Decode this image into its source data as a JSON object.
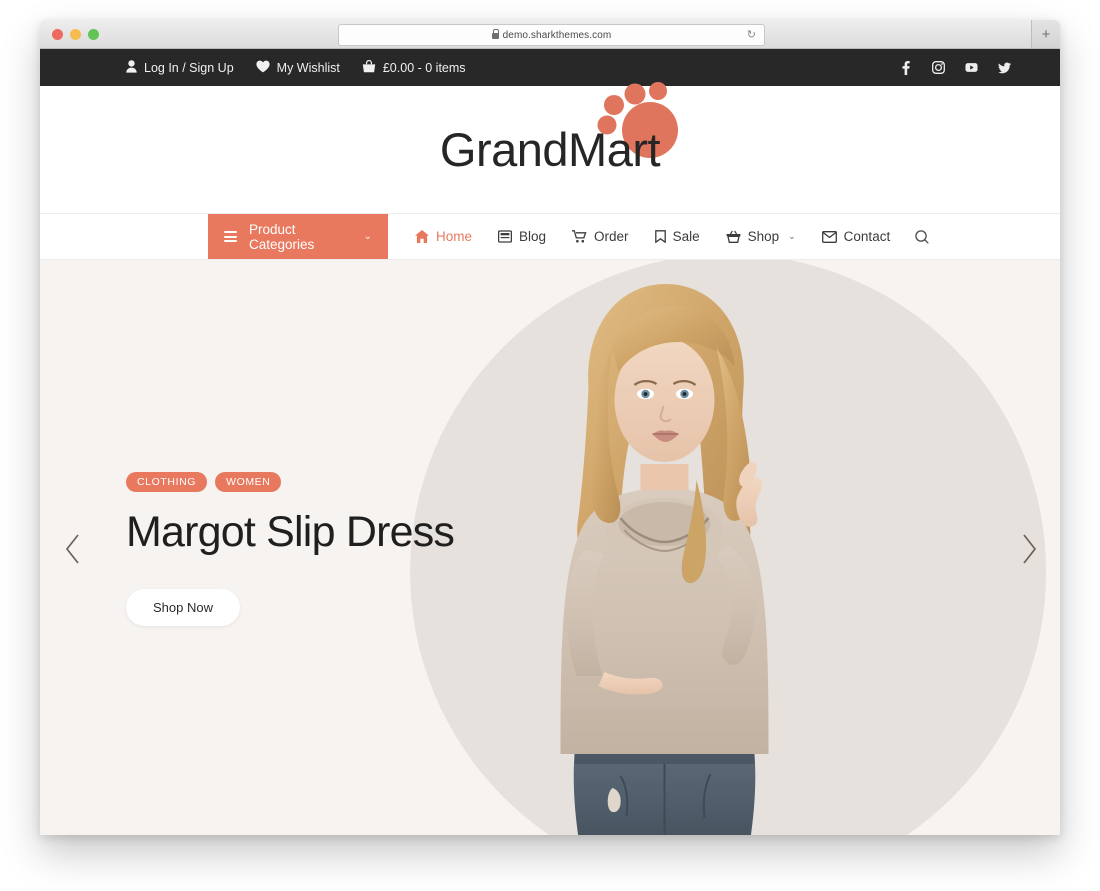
{
  "browser": {
    "url": "demo.sharkthemes.com",
    "lock_icon": "lock-icon",
    "reload_icon": "reload-icon",
    "newtab_label": "+"
  },
  "topbar": {
    "login": {
      "label": "Log In / Sign Up",
      "icon": "user-icon"
    },
    "wishlist": {
      "label": "My Wishlist",
      "icon": "heart-icon"
    },
    "cart": {
      "label": "£0.00 - 0 items",
      "icon": "basket-icon"
    },
    "social": [
      {
        "name": "facebook-icon"
      },
      {
        "name": "instagram-icon"
      },
      {
        "name": "youtube-icon"
      },
      {
        "name": "twitter-icon"
      }
    ]
  },
  "logo": {
    "text": "GrandMart",
    "mark": "paw-print-icon",
    "color": "#e0755d"
  },
  "nav": {
    "categories": {
      "label": "Product Categories",
      "icon": "hamburger-icon",
      "caret": "⌄",
      "bg": "#e8795f"
    },
    "items": [
      {
        "label": "Home",
        "icon": "home-icon",
        "active": true
      },
      {
        "label": "Blog",
        "icon": "blog-icon",
        "active": false
      },
      {
        "label": "Order",
        "icon": "cart-icon",
        "active": false
      },
      {
        "label": "Sale",
        "icon": "tag-icon",
        "active": false
      },
      {
        "label": "Shop",
        "icon": "basket-icon",
        "active": false,
        "caret": "⌄"
      },
      {
        "label": "Contact",
        "icon": "envelope-icon",
        "active": false
      }
    ],
    "search_icon": "search-icon"
  },
  "hero": {
    "badges": [
      "CLOTHING",
      "WOMEN"
    ],
    "title": "Margot Slip Dress",
    "cta": "Shop Now",
    "prev_icon": "chevron-left-icon",
    "next_icon": "chevron-right-icon",
    "bg_color": "#f7f3f0",
    "circle_color": "#e6e1dc"
  }
}
